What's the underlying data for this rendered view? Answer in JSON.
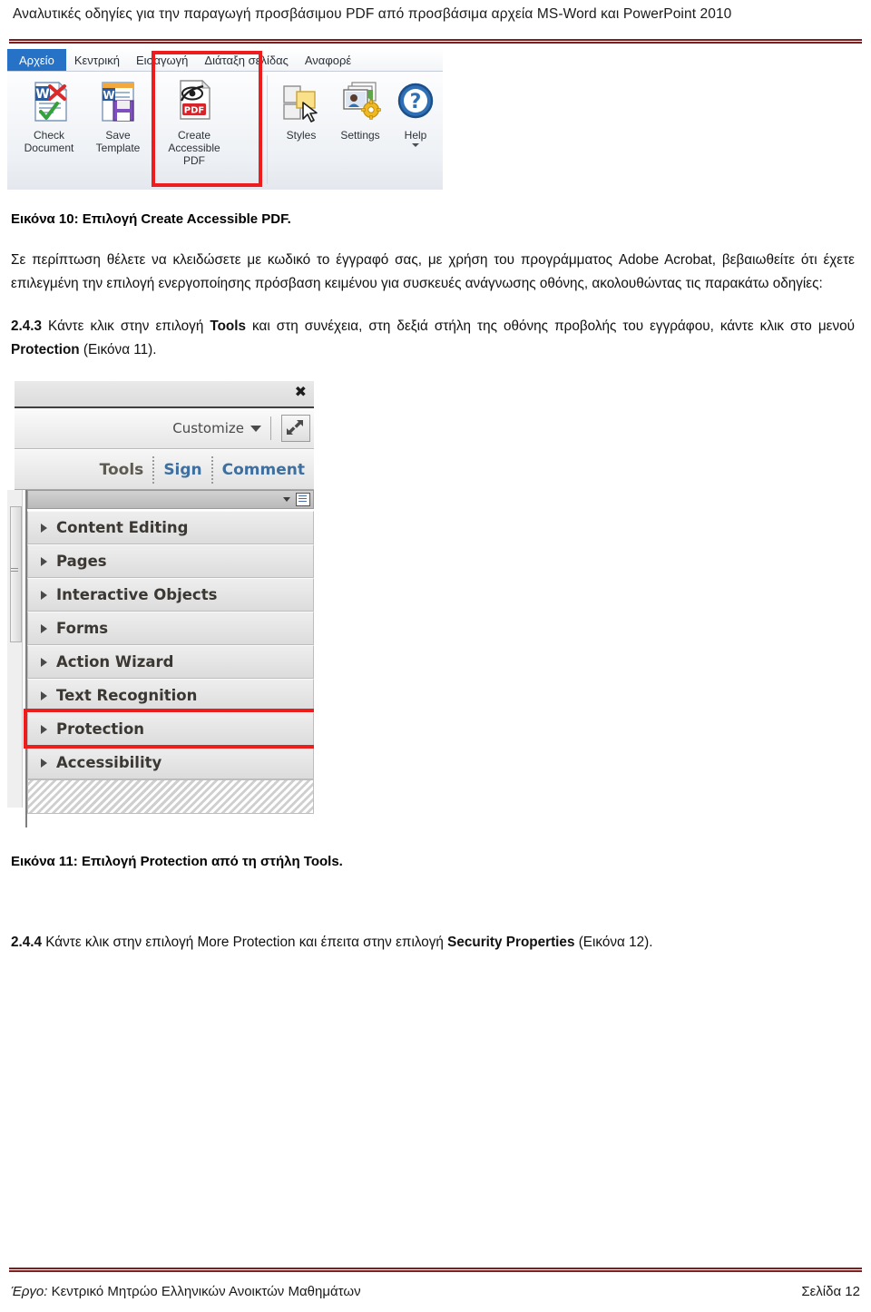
{
  "header": {
    "title": "Αναλυτικές οδηγίες για την παραγωγή προσβάσιμου PDF από προσβάσιμα αρχεία MS-Word και PowerPoint 2010"
  },
  "figure_word": {
    "tabs": [
      {
        "label": "Αρχείο",
        "active": true
      },
      {
        "label": "Κεντρική",
        "active": false
      },
      {
        "label": "Εισαγωγή",
        "active": false
      },
      {
        "label": "Διάταξη σελίδας",
        "active": false
      },
      {
        "label": "Αναφορέ",
        "active": false
      }
    ],
    "commands": [
      {
        "label": "Check\nDocument",
        "icon": "word-check-document-icon"
      },
      {
        "label": "Save\nTemplate",
        "icon": "word-save-template-icon"
      },
      {
        "label": "Create\nAccessible PDF",
        "icon": "create-accessible-pdf-icon",
        "highlighted": true
      },
      {
        "label": "Styles",
        "icon": "styles-icon"
      },
      {
        "label": "Settings",
        "icon": "settings-icon"
      },
      {
        "label": "Help",
        "icon": "help-icon",
        "has_dropdown": true
      }
    ],
    "highlight_color": "#ee1d1d"
  },
  "caption_10": "Εικόνα 10: Επιλογή Create Accessible PDF.",
  "paragraph_1": {
    "text": "Σε περίπτωση θέλετε να κλειδώσετε με κωδικό το έγγραφό σας, με χρήση του προγράμματος Adobe Acrobat, βεβαιωθείτε ότι έχετε επιλεγμένη την επιλογή ενεργοποίησης πρόσβαση κειμένου για συσκευές ανάγνωσης οθόνης, ακολουθώντας τις παρακάτω οδηγίες:"
  },
  "step_243": {
    "number": "2.4.3",
    "part1": " Κάντε κλικ στην επιλογή ",
    "bold1": "Tools",
    "part2": " και στη συνέχεια, στη δεξιά στήλη της οθόνης προβολής του εγγράφου, κάντε κλικ στο μενού ",
    "bold2": "Protection",
    "part3": " (Εικόνα 11)."
  },
  "figure_acrobat": {
    "close_icon": "✖",
    "customize_label": "Customize",
    "expand_icon": "expand-arrows-icon",
    "tabs": [
      {
        "label": "Tools",
        "state": "active"
      },
      {
        "label": "Sign",
        "state": "link"
      },
      {
        "label": "Comment",
        "state": "link"
      }
    ],
    "list_items": [
      {
        "label": "Content Editing",
        "highlighted": false
      },
      {
        "label": "Pages",
        "highlighted": false
      },
      {
        "label": "Interactive Objects",
        "highlighted": false
      },
      {
        "label": "Forms",
        "highlighted": false
      },
      {
        "label": "Action Wizard",
        "highlighted": false
      },
      {
        "label": "Text Recognition",
        "highlighted": false
      },
      {
        "label": "Protection",
        "highlighted": true
      },
      {
        "label": "Accessibility",
        "highlighted": false
      }
    ],
    "highlight_color": "#ee1d1d"
  },
  "caption_11": "Εικόνα 11: Επιλογή Protection από τη στήλη Tools.",
  "step_244": {
    "number": "2.4.4",
    "part1": " Κάντε κλικ στην επιλογή More Protection και έπειτα στην επιλογή ",
    "bold1": "Security Properties",
    "part2": " (Εικόνα 12)."
  },
  "footer": {
    "project_label": "Έργο:",
    "project_name": " Κεντρικό Μητρώο Ελληνικών Ανοικτών Μαθημάτων",
    "page": "Σελίδα 12"
  },
  "colors": {
    "rule": "#7b2020",
    "accent_tab": "#2572c6",
    "highlight": "#ee1d1d"
  }
}
